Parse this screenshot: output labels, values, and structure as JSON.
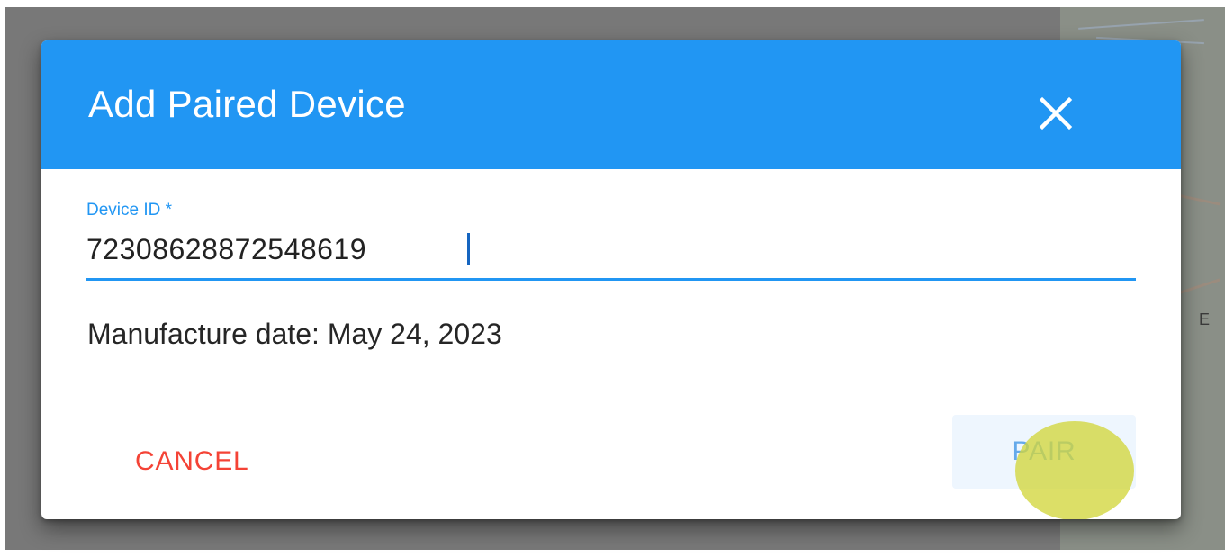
{
  "dialog": {
    "title": "Add Paired Device",
    "close_icon": "close-icon"
  },
  "device_id_field": {
    "label": "Device ID *",
    "value": "72308628872548619"
  },
  "manufacture_date_text": "Manufacture date: May 24, 2023",
  "actions": {
    "cancel_label": "CANCEL",
    "pair_label": "PAIR"
  },
  "map_edge_letter": "E",
  "colors": {
    "header": "#2196f3",
    "accent": "#2196f3",
    "cancel": "#f44336",
    "pair_text": "#64a9ea",
    "touch_indicator": "#d2d63c"
  }
}
